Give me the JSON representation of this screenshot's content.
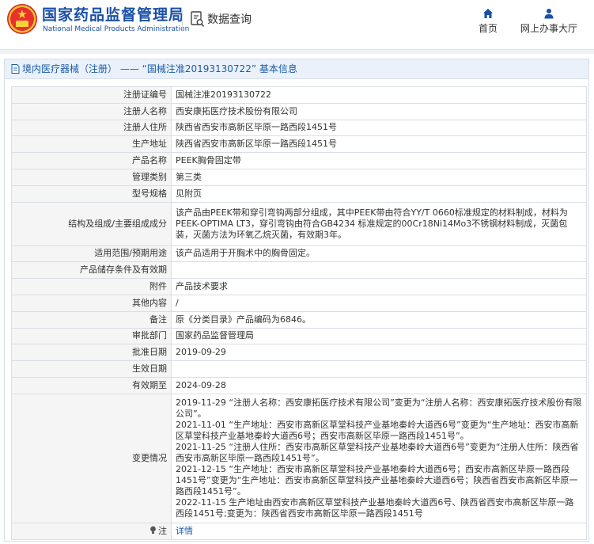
{
  "header": {
    "org_name_cn": "国家药品监督管理局",
    "org_name_en": "National Medical Products Administration",
    "section_title": "数据查询",
    "nav": [
      {
        "label": "首页",
        "icon": "home-icon"
      },
      {
        "label": "网上办事大厅",
        "icon": "person-icon"
      }
    ]
  },
  "breadcrumb": "境内医疗器械（注册） —— “国械注准20193130722” 基本信息",
  "colors": {
    "brand_blue": "#1a4fa8",
    "link_blue": "#1a5ca8",
    "label_bg": "#f5f5f5",
    "crumb_bg": "#eaf1fa"
  },
  "rows": [
    {
      "label": "注册证编号",
      "value": "国械注准20193130722"
    },
    {
      "label": "注册人名称",
      "value": "西安康拓医疗技术股份有限公司"
    },
    {
      "label": "注册人住所",
      "value": "陕西省西安市高新区毕原一路西段1451号"
    },
    {
      "label": "生产地址",
      "value": "陕西省西安市高新区毕原一路西段1451号"
    },
    {
      "label": "产品名称",
      "value": "PEEK胸骨固定带"
    },
    {
      "label": "管理类别",
      "value": "第三类"
    },
    {
      "label": "型号规格",
      "value": "见附页"
    },
    {
      "label": "结构及组成/主要组成成分",
      "value": "该产品由PEEK带和穿引弯钩两部分组成，其中PEEK带由符合YY/T 0660标准规定的材料制成，材料为PEEK-OPTIMA LT3，穿引弯钩由符合GB4234 标准规定的00Cr18Ni14Mo3不锈钢材料制成，灭菌包装，灭菌方法为环氧乙烷灭菌，有效期3年。"
    },
    {
      "label": "适用范围/预期用途",
      "value": "该产品适用于开胸术中的胸骨固定。"
    },
    {
      "label": "产品储存条件及有效期",
      "value": ""
    },
    {
      "label": "附件",
      "value": "产品技术要求"
    },
    {
      "label": "其他内容",
      "value": "/"
    },
    {
      "label": "备注",
      "value": "原《分类目录》产品编码为6846。"
    },
    {
      "label": "审批部门",
      "value": "国家药品监督管理局"
    },
    {
      "label": "批准日期",
      "value": "2019-09-29"
    },
    {
      "label": "生效日期",
      "value": ""
    },
    {
      "label": "有效期至",
      "value": "2024-09-28"
    }
  ],
  "changes": {
    "label": "变更情况",
    "items": [
      "2019-11-29 “注册人名称：西安康拓医疗技术有限公司”变更为“注册人名称：西安康拓医疗技术股份有限公司”。",
      "2021-11-01 “生产地址：西安市高新区草堂科技产业基地秦岭大道西6号”变更为“生产地址：西安市高新区草堂科技产业基地秦岭大道西6号；西安市高新区毕原一路西段1451号”。",
      "2021-11-25 “注册人住所：西安市高新区草堂科技产业基地秦岭大道西6号”变更为“注册人住所：陕西省西安市高新区毕原一路西段1451号”。",
      "2021-12-15 “生产地址：西安市高新区草堂科技产业基地秦岭大道西6号；西安市高新区毕原一路西段1451号”变更为“生产地址：西安市高新区草堂科技产业基地秦岭大道西6号；陕西省西安市高新区毕原一路西段1451号”。",
      "2022-11-15 生产地址由西安市高新区草堂科技产业基地秦岭大道西6号、陕西省西安市高新区毕原一路西段1451号;变更为：陕西省西安市高新区毕原一路西段1451号"
    ]
  },
  "note": {
    "label": "注",
    "link": "详情",
    "icon": "bulb-icon"
  }
}
